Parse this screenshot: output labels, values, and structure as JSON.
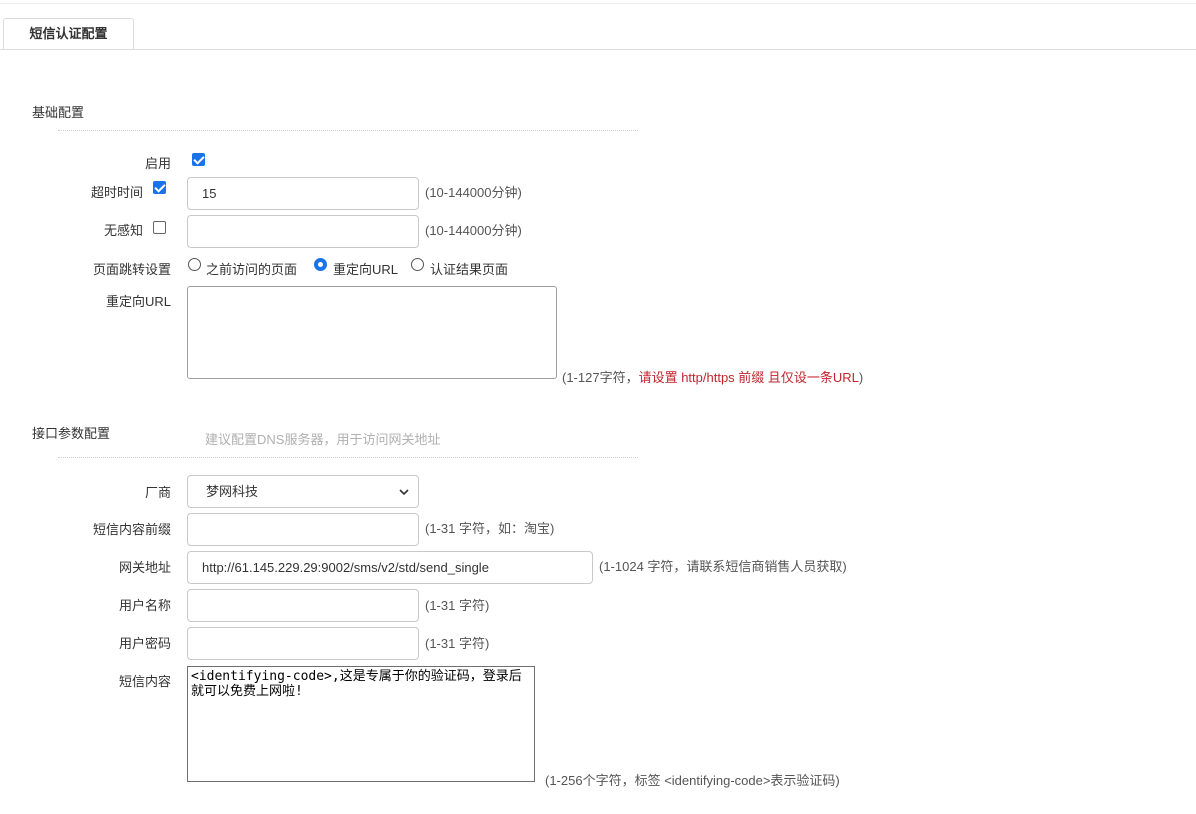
{
  "tab": {
    "label": "短信认证配置"
  },
  "basic": {
    "title": "基础配置",
    "enable_label": "启用",
    "timeout_label": "超时时间",
    "timeout_value": "15",
    "timeout_hint": "(10-144000分钟)",
    "noperceive_label": "无感知",
    "noperceive_hint": "(10-144000分钟)",
    "redirect_label": "页面跳转设置",
    "redirect_options": [
      "之前访问的页面",
      "重定向URL",
      "认证结果页面"
    ],
    "redirect_selected": "重定向URL",
    "url_label": "重定向URL",
    "url_hint_prefix": "(1-127字符，",
    "url_hint_red": "请设置 http/https 前缀 且仅设一条URL",
    "url_hint_suffix": ")"
  },
  "api": {
    "title": "接口参数配置",
    "dns_hint": "建议配置DNS服务器，用于访问网关地址",
    "vendor_label": "厂商",
    "vendor_value": "梦网科技",
    "prefix_label": "短信内容前缀",
    "prefix_hint": "(1-31 字符，如：淘宝)",
    "gateway_label": "网关地址",
    "gateway_value": "http://61.145.229.29:9002/sms/v2/std/send_single",
    "gateway_hint": "(1-1024 字符，请联系短信商销售人员获取)",
    "username_label": "用户名称",
    "username_hint": "(1-31 字符)",
    "password_label": "用户密码",
    "password_hint": "(1-31 字符)",
    "content_label": "短信内容",
    "content_value": "<identifying-code>,这是专属于你的验证码，登录后就可以免费上网啦!",
    "content_hint": "(1-256个字符，标签 <identifying-code>表示验证码)"
  },
  "colors": {
    "accent": "#1a73e8",
    "warning_red": "#c0262c"
  }
}
